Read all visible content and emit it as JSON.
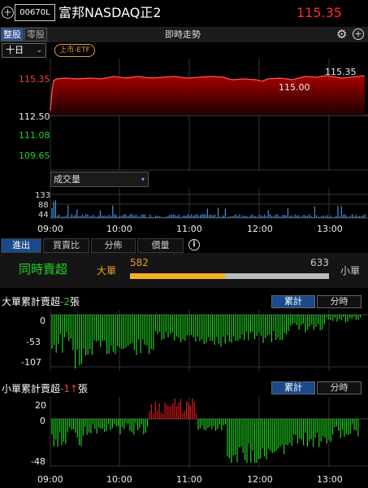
{
  "header": {
    "plus_icon": "+",
    "code": "00670L",
    "name": "富邦NASDAQ正2",
    "price": "115.35"
  },
  "toolbar": {
    "tab_whole": "整股",
    "tab_odd": "零股",
    "title": "即時走勢",
    "gear_icon": "⚙",
    "add_icon": "+"
  },
  "controls": {
    "period": "十日",
    "period_chevron": "⌄",
    "etf_badge": "上市-ETF"
  },
  "price_chart": {
    "y_labels": [
      "115.35",
      "112.50",
      "111.08",
      "109.65"
    ],
    "high_label": "115.35",
    "mid_label": "115.00",
    "colors": {
      "up": "#ff3b3b",
      "flat": "#eeeeee",
      "down": "#1fd31f"
    }
  },
  "volume": {
    "selector_label": "成交量",
    "selector_chevron": "▾",
    "y_labels": [
      "133",
      "88",
      "44"
    ]
  },
  "time_axis": [
    "09:00",
    "10:00",
    "11:00",
    "12:00",
    "13:00"
  ],
  "lower_tabs": {
    "in": "進出",
    "ratio": "買賣比",
    "dist": "分佈",
    "amount": "價量",
    "info_icon": "i"
  },
  "summary": {
    "label": "同時賣超",
    "big_label": "大單",
    "big_value": "582",
    "small_value": "633",
    "small_label": "小單",
    "big_share": 0.479
  },
  "big_cumulative": {
    "title_prefix": "大單累計賣超",
    "title_value": "-2",
    "title_suffix": "張",
    "seg_cumulative": "累計",
    "seg_period": "分時",
    "y_labels": [
      "0",
      "-53",
      "-107"
    ]
  },
  "small_cumulative": {
    "title_prefix": "小單累計賣超",
    "title_value": "-1",
    "title_arrow": "↑",
    "title_suffix": "張",
    "seg_cumulative": "累計",
    "seg_period": "分時",
    "y_labels": [
      "20",
      "0",
      "-48"
    ]
  },
  "bottom_time_axis": [
    "09:00",
    "10:00",
    "11:00",
    "12:00",
    "13:00"
  ]
}
